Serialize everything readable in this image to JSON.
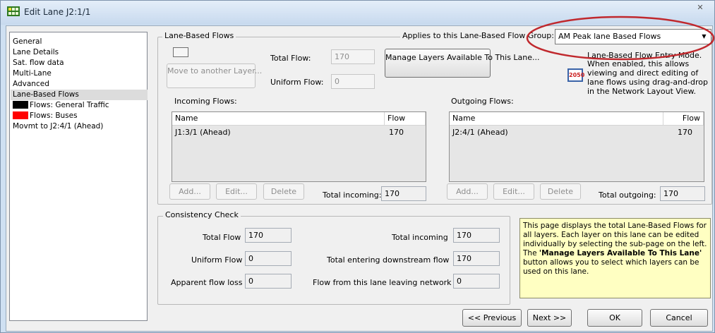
{
  "window": {
    "title": "Edit Lane J2:1/1",
    "close_glyph": "✕",
    "app_icon": "grid-app-icon"
  },
  "sidebar": {
    "items": [
      {
        "label": "General"
      },
      {
        "label": "Lane Details"
      },
      {
        "label": "Sat. flow data"
      },
      {
        "label": "Multi-Lane"
      },
      {
        "label": "Advanced"
      },
      {
        "label": "Lane-Based Flows",
        "selected": true
      },
      {
        "label": "Flows: General Traffic",
        "swatch": "#000000"
      },
      {
        "label": "Flows: Buses",
        "swatch": "#ff0000"
      },
      {
        "label": "Movmt to J2:4/1 (Ahead)"
      }
    ]
  },
  "lane_flows": {
    "group_label": "Lane-Based Flows",
    "applies_label": "Applies to this Lane-Based Flow Group:",
    "flow_group_value": "AM Peak lane Based Flows",
    "move_button": "Move to another Layer...",
    "total_flow_label": "Total Flow:",
    "total_flow_value": "170",
    "uniform_flow_label": "Uniform Flow:",
    "uniform_flow_value": "0",
    "manage_layers_button": "Manage Layers Available To This Lane...",
    "entry_mode_text_1": "Lane-Based Flow Entry Mode.",
    "entry_mode_text_2": "When enabled, this allows viewing and direct editing of lane flows using drag-and-drop in the Network Layout View.",
    "entry_mode_icon_text": "2050"
  },
  "incoming": {
    "label": "Incoming Flows:",
    "columns": [
      "Name",
      "Flow"
    ],
    "rows": [
      {
        "name": "J1:3/1 (Ahead)",
        "flow": "170"
      }
    ],
    "add_button": "Add...",
    "edit_button": "Edit...",
    "delete_button": "Delete",
    "total_label": "Total incoming:",
    "total_value": "170"
  },
  "outgoing": {
    "label": "Outgoing Flows:",
    "columns": [
      "Name",
      "Flow"
    ],
    "rows": [
      {
        "name": "J2:4/1 (Ahead)",
        "flow": "170"
      }
    ],
    "add_button": "Add...",
    "edit_button": "Edit...",
    "delete_button": "Delete",
    "total_label": "Total outgoing:",
    "total_value": "170"
  },
  "consistency": {
    "group_label": "Consistency Check",
    "total_flow_label": "Total Flow",
    "total_flow_value": "170",
    "uniform_flow_label": "Uniform Flow",
    "uniform_flow_value": "0",
    "apparent_loss_label": "Apparent flow loss",
    "apparent_loss_value": "0",
    "total_incoming_label": "Total incoming",
    "total_incoming_value": "170",
    "total_entering_label": "Total entering downstream flow",
    "total_entering_value": "170",
    "leaving_label": "Flow from this lane leaving network",
    "leaving_value": "0"
  },
  "help": {
    "p1": "This page displays the total Lane-Based Flows for all layers. Each layer on this lane can be edited individually by selecting the sub-page on the left.",
    "p2_prefix": "The ",
    "p2_bold": "'Manage Layers Available To This Lane'",
    "p2_suffix": " button allows you to select which layers can be used on this lane."
  },
  "footer": {
    "previous": "<< Previous",
    "next": "Next >>",
    "ok": "OK",
    "cancel": "Cancel"
  },
  "colors": {
    "annotation_ellipse": "#c0282d",
    "help_background": "#ffffc2"
  }
}
